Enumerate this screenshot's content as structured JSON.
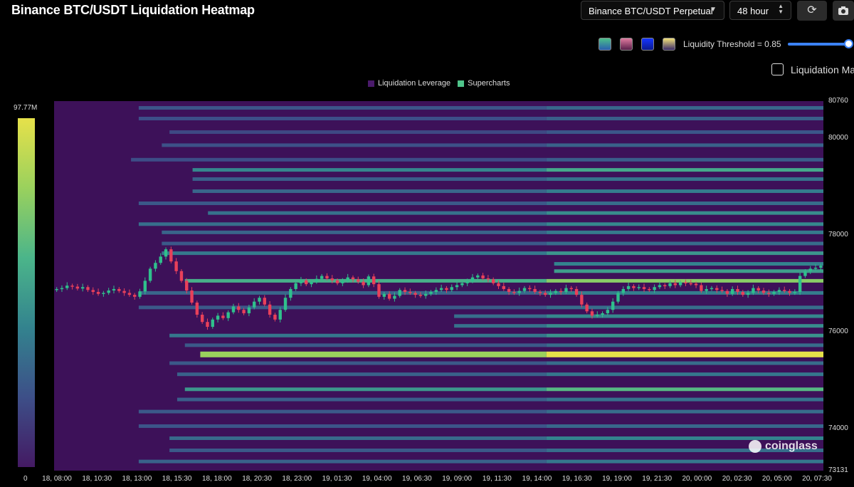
{
  "header": {
    "title": "Binance BTC/USDT Liquidation Heatmap",
    "pair_select": "Binance BTC/USDT Perpetual",
    "range_select": "48 hour",
    "refresh_icon": "refresh-icon",
    "camera_icon": "camera-icon"
  },
  "controls": {
    "threshold_label": "Liquidity Threshold = 0.85",
    "threshold_value": 0.85,
    "checkbox_label": "Liquidation Map",
    "checkbox_checked": false,
    "palette_swatches": [
      {
        "name": "viridis",
        "from": "#4bc08a",
        "to": "#2a5fb0"
      },
      {
        "name": "rose",
        "from": "#e07ba0",
        "to": "#5a1f4a"
      },
      {
        "name": "blue",
        "from": "#1535ff",
        "to": "#0a1a90"
      },
      {
        "name": "sunset",
        "from": "#f3e27a",
        "to": "#3a2a6a"
      }
    ]
  },
  "colorbar": {
    "max_label": "97.77M",
    "min_label": "0"
  },
  "watermark": "coinglass",
  "chart_data": {
    "type": "heatmap",
    "title": "Binance BTC/USDT Liquidation Heatmap",
    "legend": [
      {
        "name": "Liquidation Leverage",
        "color": "#4a1a6b"
      },
      {
        "name": "Supercharts",
        "color": "#4fc48a"
      }
    ],
    "legend_position": "top-center",
    "y_ticks": [
      "80760",
      "80000",
      "78000",
      "76000",
      "74000",
      "73131"
    ],
    "ylim": [
      73131,
      80760
    ],
    "x_ticks": [
      "18, 08:00",
      "18, 10:30",
      "18, 13:00",
      "18, 15:30",
      "18, 18:00",
      "18, 20:30",
      "18, 23:00",
      "19, 01:30",
      "19, 04:00",
      "19, 06:30",
      "19, 09:00",
      "19, 11:30",
      "19, 14:00",
      "19, 16:30",
      "19, 19:00",
      "19, 21:30",
      "20, 00:00",
      "20, 02:30",
      "20, 05:00",
      "20, 07:30"
    ],
    "color_scale": [
      "#441a63",
      "#3d4f88",
      "#33838e",
      "#4bb58a",
      "#9ad15d",
      "#e6e14a"
    ],
    "liquidation_bands": [
      {
        "price": 80620,
        "start": 0.11,
        "level": 0.28
      },
      {
        "price": 80400,
        "start": 0.11,
        "level": 0.25
      },
      {
        "price": 80120,
        "start": 0.15,
        "level": 0.22
      },
      {
        "price": 79850,
        "start": 0.14,
        "level": 0.26
      },
      {
        "price": 79550,
        "start": 0.1,
        "level": 0.24
      },
      {
        "price": 79340,
        "start": 0.18,
        "level": 0.52
      },
      {
        "price": 79150,
        "start": 0.18,
        "level": 0.32
      },
      {
        "price": 78900,
        "start": 0.18,
        "level": 0.36
      },
      {
        "price": 78650,
        "start": 0.11,
        "level": 0.3
      },
      {
        "price": 78450,
        "start": 0.2,
        "level": 0.42
      },
      {
        "price": 78220,
        "start": 0.11,
        "level": 0.4
      },
      {
        "price": 78050,
        "start": 0.14,
        "level": 0.35
      },
      {
        "price": 77820,
        "start": 0.14,
        "level": 0.3
      },
      {
        "price": 77620,
        "start": 0.14,
        "level": 0.45
      },
      {
        "price": 77400,
        "start": 0.65,
        "level": 0.38
      },
      {
        "price": 77250,
        "start": 0.65,
        "level": 0.48
      },
      {
        "price": 77050,
        "start": 0.17,
        "level": 0.72
      },
      {
        "price": 76800,
        "start": 0.11,
        "level": 0.36
      },
      {
        "price": 76500,
        "start": 0.11,
        "level": 0.3
      },
      {
        "price": 76320,
        "start": 0.52,
        "level": 0.4
      },
      {
        "price": 76120,
        "start": 0.52,
        "level": 0.42
      },
      {
        "price": 75920,
        "start": 0.15,
        "level": 0.44
      },
      {
        "price": 75720,
        "start": 0.17,
        "level": 0.3
      },
      {
        "price": 75530,
        "start": 0.19,
        "level": 1.0
      },
      {
        "price": 75350,
        "start": 0.15,
        "level": 0.3
      },
      {
        "price": 75120,
        "start": 0.16,
        "level": 0.34
      },
      {
        "price": 74810,
        "start": 0.17,
        "level": 0.6
      },
      {
        "price": 74600,
        "start": 0.16,
        "level": 0.32
      },
      {
        "price": 74350,
        "start": 0.11,
        "level": 0.3
      },
      {
        "price": 74050,
        "start": 0.11,
        "level": 0.28
      },
      {
        "price": 73800,
        "start": 0.15,
        "level": 0.38
      },
      {
        "price": 73550,
        "start": 0.15,
        "level": 0.3
      },
      {
        "price": 73320,
        "start": 0.11,
        "level": 0.34
      }
    ],
    "price_series": {
      "name": "BTC/USDT",
      "close": [
        76880,
        76900,
        76950,
        76930,
        76890,
        76920,
        76860,
        76820,
        76780,
        76800,
        76850,
        76880,
        76840,
        76800,
        76760,
        76720,
        76830,
        77050,
        77300,
        77420,
        77550,
        77700,
        77450,
        77250,
        77050,
        76850,
        76600,
        76350,
        76200,
        76100,
        76250,
        76330,
        76280,
        76400,
        76520,
        76450,
        76380,
        76500,
        76620,
        76700,
        76560,
        76350,
        76250,
        76450,
        76700,
        76880,
        77000,
        77060,
        76980,
        77030,
        77090,
        77150,
        77100,
        77060,
        77000,
        77050,
        77120,
        77080,
        77030,
        76960,
        77140,
        76980,
        76720,
        76780,
        76680,
        76740,
        76860,
        76820,
        76800,
        76760,
        76740,
        76780,
        76820,
        76860,
        76900,
        76860,
        76920,
        76960,
        77000,
        77040,
        77120,
        77160,
        77100,
        77080,
        77000,
        76940,
        76880,
        76820,
        76800,
        76840,
        76900,
        76880,
        76820,
        76800,
        76760,
        76800,
        76840,
        76820,
        76900,
        76880,
        76760,
        76560,
        76420,
        76330,
        76350,
        76380,
        76450,
        76620,
        76800,
        76880,
        76940,
        76900,
        76920,
        76880,
        76860,
        76920,
        76960,
        76940,
        77000,
        76960,
        77020,
        77000,
        76990,
        76960,
        76840,
        76880,
        76900,
        76860,
        76840,
        76780,
        76880,
        76820,
        76760,
        76800,
        76900,
        76850,
        76800,
        76780,
        76820,
        76860,
        76840,
        76800,
        76820,
        77150,
        77250,
        77300,
        77320,
        77360
      ]
    }
  }
}
